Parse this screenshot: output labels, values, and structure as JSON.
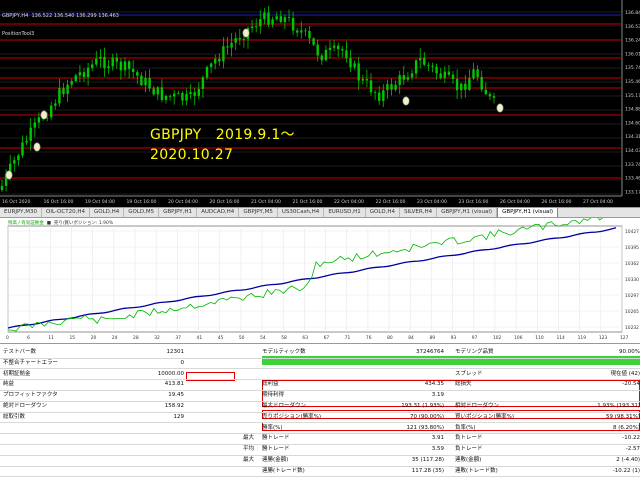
{
  "chart": {
    "header_line1": "GBPJPY,H4  136.522 136.540 136.299 136.463",
    "header_line2": "PositionTool3",
    "overlay_line1": "GBPJPY　2019.9.1～",
    "overlay_line2": "2020.10.27",
    "price_labels": [
      "136.845",
      "136.530",
      "136.245",
      "136.015",
      "135.740",
      "135.460",
      "135.175",
      "134.885",
      "134.600",
      "134.315",
      "134.030",
      "133.745",
      "133.460",
      "133.175"
    ],
    "time_labels": [
      "16 Oct 2020",
      "16 Oct 16:00",
      "19 Oct 04:00",
      "19 Oct 16:00",
      "20 Oct 04:00",
      "20 Oct 16:00",
      "21 Oct 04:00",
      "21 Oct 16:00",
      "22 Oct 04:00",
      "22 Oct 16:00",
      "23 Oct 04:00",
      "23 Oct 16:00",
      "26 Oct 04:00",
      "26 Oct 16:00",
      "27 Oct 04:00"
    ],
    "colors": {
      "background": "#000000",
      "bull": "#00c800",
      "bear": "#00c800",
      "level": "#c80000",
      "level_blue": "#1e1eb4"
    }
  },
  "tabs": [
    "EURJPY,M30",
    "OIL-OCT20,H4",
    "GOLD,H4",
    "GOLD,M5",
    "GBPJPY,H1",
    "AUDCAD,H4",
    "GBPJPY,M5",
    "US30Cash,H4",
    "EURUSD,H1",
    "GOLD,H4",
    "SILVER,H4",
    "GBPJPY,H1 (visual)",
    "GBPJPY,H1 (visual)"
  ],
  "active_tab": 12,
  "equity": {
    "legend_1": "残高 / 有効証拠金",
    "legend_2": "売り/買いポジション: 1.90%",
    "y_labels": [
      "10427",
      "10395",
      "10362",
      "10330",
      "10297",
      "10265",
      "10232"
    ],
    "x_labels": [
      "0",
      "6",
      "11",
      "15",
      "20",
      "24",
      "28",
      "32",
      "37",
      "41",
      "45",
      "50",
      "54",
      "58",
      "63",
      "67",
      "71",
      "76",
      "80",
      "84",
      "89",
      "93",
      "97",
      "102",
      "106",
      "110",
      "114",
      "119",
      "123",
      "127"
    ],
    "colors": {
      "balance": "#0000a0",
      "equity": "#00b400"
    }
  },
  "report": {
    "rows": [
      [
        "テストバー数",
        "12301",
        "モデルティック数",
        "37246764",
        "モデリング品質",
        "90.00%"
      ],
      [
        "不整合チャートエラー",
        "0",
        "",
        "",
        "",
        ""
      ],
      [
        "初期証拠金",
        "10000.00",
        "",
        "",
        "スプレッド",
        "現在値 (42)"
      ],
      [
        "純益",
        "413.81",
        "総利益",
        "434.35",
        "総損失",
        "-20.54"
      ],
      [
        "プロフィットファクタ",
        "19.45",
        "期待利得",
        "3.19",
        "",
        ""
      ],
      [
        "絶対ドローダウン",
        "158.92",
        "最大ドローダウン",
        "193.31 (1.93%)",
        "相対ドローダウン",
        "1.93% (193.31)"
      ],
      [
        "総取引数",
        "129",
        "売りポジション(勝率%)",
        "70 (90.00%)",
        "買いポジション(勝率%)",
        "59 (98.31%)"
      ],
      [
        "",
        "",
        "勝率(%)",
        "121 (93.80%)",
        "負率(%)",
        "8 (6.20%)"
      ],
      [
        "",
        "最大",
        "勝トレード",
        "3.91",
        "負トレード",
        "-10.22"
      ],
      [
        "",
        "平均",
        "勝トレード",
        "3.59",
        "負トレード",
        "-2.57"
      ],
      [
        "",
        "最大",
        "連勝(金額)",
        "35 (117.28)",
        "連敗(金額)",
        "2 (-4.40)"
      ],
      [
        "",
        "",
        "連勝(トレード数)",
        "117.28 (35)",
        "連敗(トレード数)",
        "-10.22 (1)"
      ]
    ],
    "highlight_color": "#e00000",
    "quality_bar_color": "#3cd23c"
  }
}
